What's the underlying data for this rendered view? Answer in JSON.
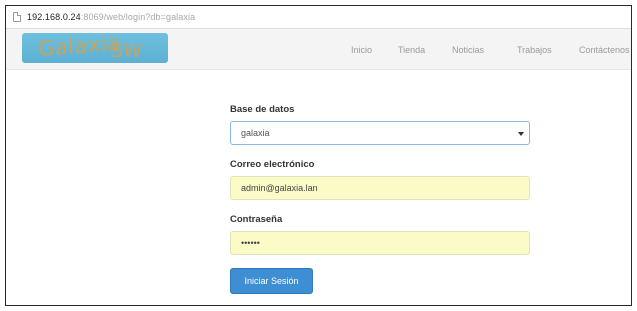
{
  "browser": {
    "url_host": "192.168.0.24",
    "url_rest": ":8069/web/login?db=galaxia"
  },
  "navbar": {
    "logo_text": "Galaxia",
    "logo_suffix": "SW",
    "items": [
      "Inicio",
      "Tienda",
      "Noticias",
      "Trabajos",
      "Contáctenos"
    ]
  },
  "login_form": {
    "database_label": "Base de datos",
    "database_value": "galaxia",
    "email_label": "Correo electrónico",
    "email_value": "admin@galaxia.lan",
    "password_label": "Contraseña",
    "password_mask": "••••••",
    "submit_label": "Iniciar Sesión"
  },
  "colors": {
    "accent": "#3e8ed4",
    "autofill_background": "#fafbc6",
    "logo_background": "#5db0d3"
  }
}
